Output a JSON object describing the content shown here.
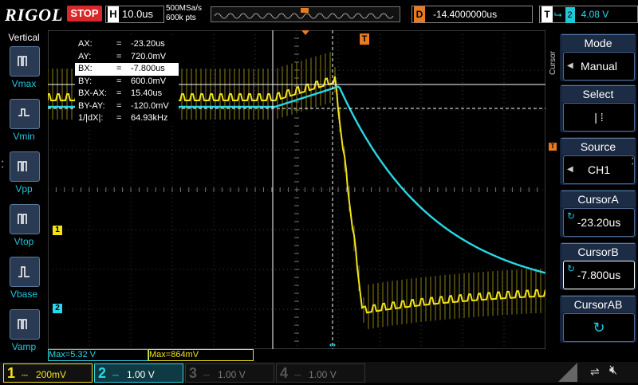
{
  "topbar": {
    "brand": "RIGOL",
    "run_state": "STOP",
    "h_label": "H",
    "timebase": "10.0us",
    "sample_rate": "500MSa/s",
    "memory_depth": "600k pts",
    "delay_label": "D",
    "delay_value": "-14.4000000us",
    "trigger_label": "T",
    "trigger_channel": "2",
    "trigger_level": "4.08 V",
    "trigger_color": "#2ad7e6"
  },
  "left_panel": {
    "title": "Vertical",
    "buttons": [
      {
        "label": "Vmax",
        "icon": "vmax-icon"
      },
      {
        "label": "Vmin",
        "icon": "vmin-icon"
      },
      {
        "label": "Vpp",
        "icon": "vpp-icon"
      },
      {
        "label": "Vtop",
        "icon": "vtop-icon"
      },
      {
        "label": "Vbase",
        "icon": "vbase-icon"
      },
      {
        "label": "Vamp",
        "icon": "vamp-icon"
      }
    ]
  },
  "cursor_readout": [
    {
      "key": "AX:",
      "value": "-23.20us"
    },
    {
      "key": "AY:",
      "value": "720.0mV"
    },
    {
      "key": "BX:",
      "value": "-7.800us"
    },
    {
      "key": "BY:",
      "value": "600.0mV"
    },
    {
      "key": "BX-AX:",
      "value": "15.40us"
    },
    {
      "key": "BY-AY:",
      "value": "-120.0mV"
    },
    {
      "key": "1/|dX|:",
      "value": "64.93kHz"
    }
  ],
  "right_panel": {
    "side_label": "Cursor",
    "items": [
      {
        "head": "Mode",
        "value": "Manual"
      },
      {
        "head": "Select",
        "value": "|  ⁞"
      },
      {
        "head": "Source",
        "value": "CH1"
      },
      {
        "head": "CursorA",
        "value": "-23.20us"
      },
      {
        "head": "CursorB",
        "value": "-7.800us"
      },
      {
        "head": "CursorAB",
        "value": ""
      }
    ]
  },
  "measurements": {
    "ch1_max": "Max=5.32 V",
    "ch2_max": "Max=864mV"
  },
  "channels": [
    {
      "num": "1",
      "scale": "200mV",
      "color": "#f2e21a",
      "active": true
    },
    {
      "num": "2",
      "scale": "1.00 V",
      "color": "#2ad7e6",
      "active": true
    },
    {
      "num": "3",
      "scale": "1.00 V",
      "color": "#c0388f",
      "active": false
    },
    {
      "num": "4",
      "scale": "1.00 V",
      "color": "#3a64d8",
      "active": false
    }
  ],
  "markers": {
    "ch1": "1",
    "ch2": "2",
    "trigger_top": "T"
  },
  "colors": {
    "ch1": "#f2e21a",
    "ch2": "#2ad7e6",
    "delay_accent": "#e97a1f",
    "panel": "#14233a"
  }
}
